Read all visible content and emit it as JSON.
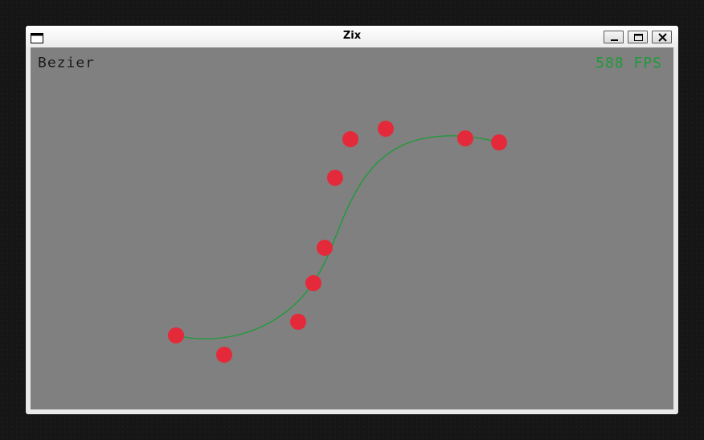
{
  "window": {
    "title": "Zix",
    "icon": "window-icon",
    "controls": {
      "minimize": "minimize-icon",
      "maximize": "maximize-icon",
      "close": "close-icon"
    }
  },
  "scene": {
    "name": "Bezier",
    "fps_text": "588 FPS",
    "colors": {
      "background": "#808080",
      "curve": "#1f9a3a",
      "points": "#e42a3a",
      "fps": "#1f9a3a",
      "title": "#1a1a1a"
    }
  }
}
